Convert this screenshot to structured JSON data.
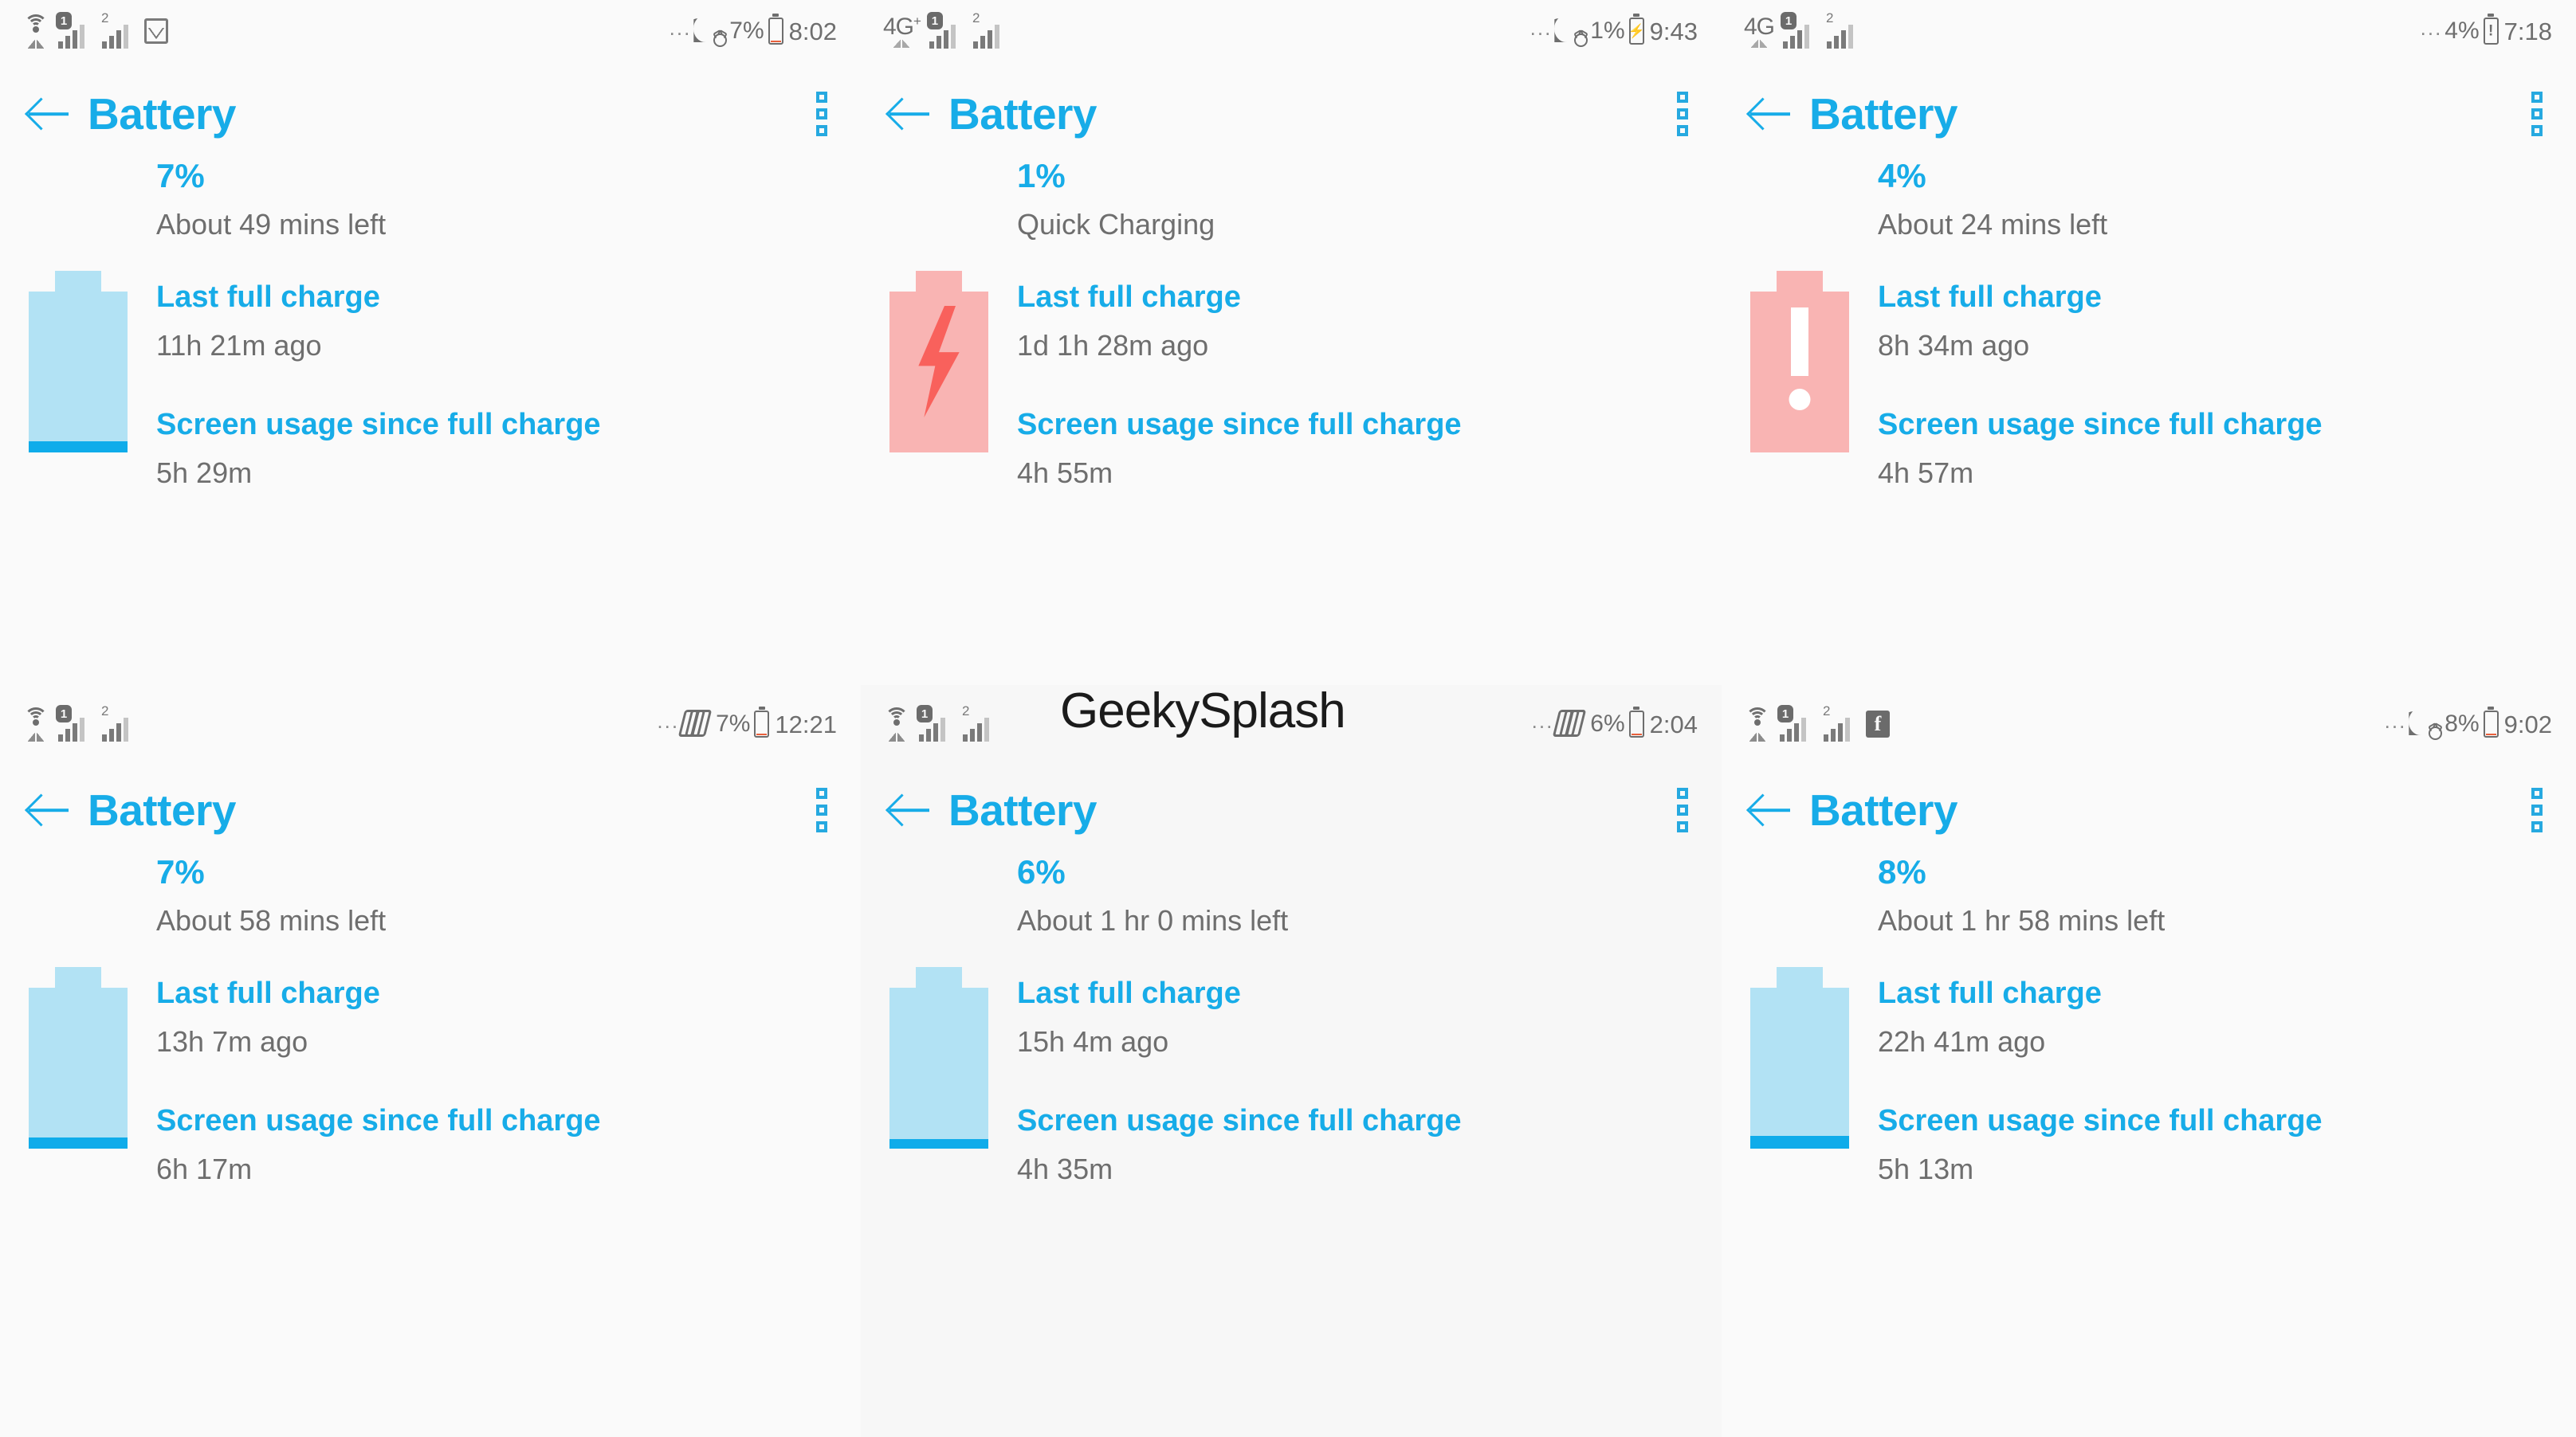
{
  "watermark": "GeekySplash",
  "labels": {
    "last_full_charge": "Last full charge",
    "screen_usage": "Screen usage since full charge",
    "app_title": "Battery"
  },
  "panels": [
    {
      "id": "panel-1",
      "status": {
        "network_icon": "wifi-icon",
        "network_label": "",
        "sim1": "1",
        "sim2": "2",
        "extra_icon": "gallery-icon",
        "more_dots": "...",
        "mode_icon": "moon-alarm-icon",
        "percent": "7%",
        "battery_icon": "battery-low-icon",
        "battery_level": 7,
        "time": "8:02"
      },
      "title": "Battery",
      "percent": "7%",
      "time_left": "About 49 mins left",
      "last_full_charge": "11h 21m ago",
      "screen_usage": "5h 29m",
      "battery": {
        "state": "discharging",
        "level": 7,
        "color": "#0facea",
        "shell": "#b2e2f4"
      }
    },
    {
      "id": "panel-2",
      "status": {
        "network_icon": "network-4g-plus-icon",
        "network_label": "4G",
        "network_sup": "+",
        "sim1": "1",
        "sim2": "2",
        "extra_icon": "",
        "more_dots": "...",
        "mode_icon": "moon-alarm-icon",
        "percent": "1%",
        "battery_icon": "battery-charging-icon",
        "battery_level": 1,
        "time": "9:43"
      },
      "title": "Battery",
      "percent": "1%",
      "time_left": "Quick Charging",
      "last_full_charge": "1d 1h 28m ago",
      "screen_usage": "4h 55m",
      "battery": {
        "state": "charging",
        "level": 100,
        "color": "#f9615c",
        "shell": "#f9b4b3"
      }
    },
    {
      "id": "panel-3",
      "status": {
        "network_icon": "network-4g-icon",
        "network_label": "4G",
        "network_sup": "",
        "sim1": "1",
        "sim2": "2",
        "extra_icon": "",
        "more_dots": "...",
        "mode_icon": "",
        "percent": "4%",
        "battery_icon": "battery-alert-icon",
        "battery_level": 4,
        "time": "7:18"
      },
      "title": "Battery",
      "percent": "4%",
      "time_left": "About 24 mins left",
      "last_full_charge": "8h 34m ago",
      "screen_usage": "4h 57m",
      "battery": {
        "state": "alert",
        "level": 0,
        "color": "#ffffff",
        "shell": "#f9b4b3"
      }
    },
    {
      "id": "panel-4",
      "status": {
        "network_icon": "wifi-icon",
        "network_label": "",
        "sim1": "1",
        "sim2": "2",
        "extra_icon": "",
        "more_dots": "...",
        "mode_icon": "vibrate-icon",
        "percent": "7%",
        "battery_icon": "battery-low-icon",
        "battery_level": 7,
        "time": "12:21"
      },
      "title": "Battery",
      "percent": "7%",
      "time_left": "About 58 mins left",
      "last_full_charge": "13h 7m ago",
      "screen_usage": "6h 17m",
      "battery": {
        "state": "discharging",
        "level": 7,
        "color": "#0facea",
        "shell": "#b2e2f4"
      }
    },
    {
      "id": "panel-5",
      "status": {
        "network_icon": "wifi-icon",
        "network_label": "",
        "sim1": "1",
        "sim2": "2",
        "extra_icon": "",
        "more_dots": "...",
        "mode_icon": "vibrate-icon",
        "percent": "6%",
        "battery_icon": "battery-low-icon",
        "battery_level": 6,
        "time": "2:04"
      },
      "title": "Battery",
      "percent": "6%",
      "time_left": "About 1 hr 0 mins left",
      "last_full_charge": "15h 4m ago",
      "screen_usage": "4h 35m",
      "battery": {
        "state": "discharging",
        "level": 6,
        "color": "#0facea",
        "shell": "#b2e2f4"
      }
    },
    {
      "id": "panel-6",
      "status": {
        "network_icon": "wifi-icon",
        "network_label": "",
        "sim1": "1",
        "sim2": "2",
        "extra_icon": "facebook-icon",
        "more_dots": "...",
        "mode_icon": "moon-alarm-icon",
        "percent": "8%",
        "battery_icon": "battery-low-icon",
        "battery_level": 8,
        "time": "9:02"
      },
      "title": "Battery",
      "percent": "8%",
      "time_left": "About 1 hr 58 mins left",
      "last_full_charge": "22h 41m ago",
      "screen_usage": "5h 13m",
      "battery": {
        "state": "discharging",
        "level": 8,
        "color": "#0facea",
        "shell": "#b2e2f4"
      }
    }
  ],
  "colors": {
    "accent": "#17ace8",
    "battery_fill": "#0facea",
    "battery_shell": "#b2e2f4",
    "warn_shell": "#f9b4b3",
    "warn_fill": "#f9615c",
    "text_gray": "#6e6e6e",
    "background": "#fafafa"
  }
}
